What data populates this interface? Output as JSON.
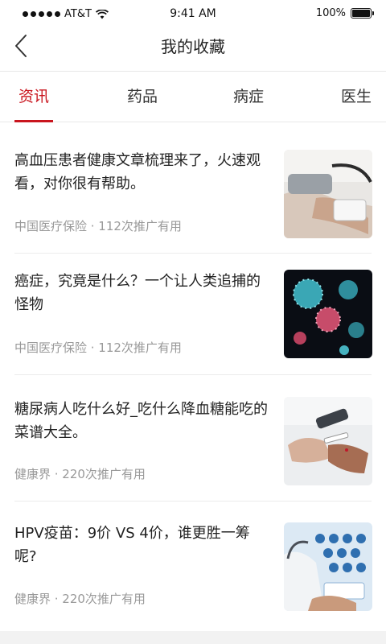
{
  "status": {
    "carrier": "AT&T",
    "time": "9:41 AM",
    "battery": "100%"
  },
  "nav": {
    "title": "我的收藏"
  },
  "tabs": [
    {
      "label": "资讯",
      "active": true
    },
    {
      "label": "药品",
      "active": false
    },
    {
      "label": "病症",
      "active": false
    },
    {
      "label": "医生",
      "active": false
    }
  ],
  "articles": [
    {
      "title": "高血压患者健康文章梳理来了，火速观看，对你很有帮助。",
      "source": "中国医疗保险",
      "meta": "中国医疗保险 · 112次推广有用",
      "thumb": "blood-pressure-photo"
    },
    {
      "title": "癌症，究竟是什么？一个让人类追捕的怪物",
      "source": "中国医疗保险",
      "meta": "中国医疗保险 · 112次推广有用",
      "thumb": "virus-cells-photo"
    },
    {
      "title": "糖尿病人吃什么好_吃什么降血糖能吃的菜谱大全。",
      "source": "健康界",
      "meta": "健康界 · 220次推广有用",
      "thumb": "glucose-test-photo"
    },
    {
      "title": "HPV疫苗：9价 VS 4价，谁更胜一筹呢?",
      "source": "健康界",
      "meta": "健康界 · 220次推广有用",
      "thumb": "medical-icons-photo"
    }
  ],
  "colors": {
    "accent": "#c9151e",
    "meta_text": "#999999",
    "divider": "#ececec"
  }
}
